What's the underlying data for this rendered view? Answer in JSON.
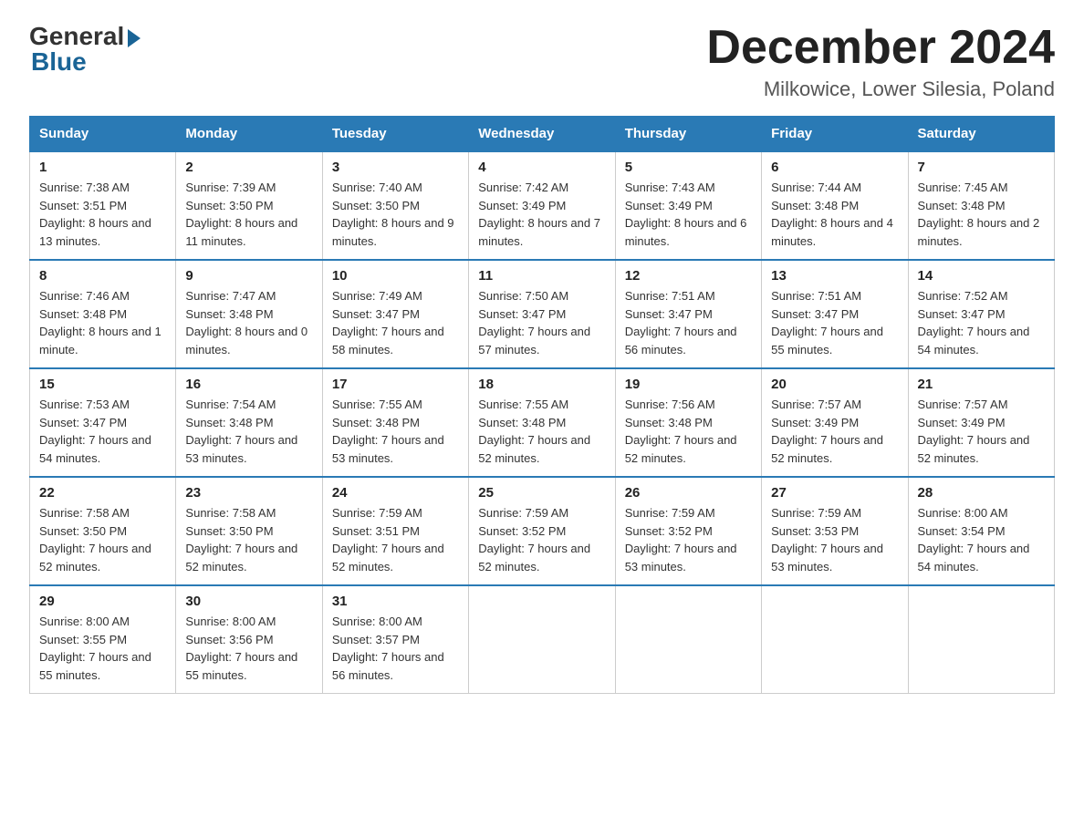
{
  "logo": {
    "general": "General",
    "blue": "Blue"
  },
  "header": {
    "month_year": "December 2024",
    "location": "Milkowice, Lower Silesia, Poland"
  },
  "days_of_week": [
    "Sunday",
    "Monday",
    "Tuesday",
    "Wednesday",
    "Thursday",
    "Friday",
    "Saturday"
  ],
  "weeks": [
    [
      {
        "day": "1",
        "sunrise": "Sunrise: 7:38 AM",
        "sunset": "Sunset: 3:51 PM",
        "daylight": "Daylight: 8 hours and 13 minutes."
      },
      {
        "day": "2",
        "sunrise": "Sunrise: 7:39 AM",
        "sunset": "Sunset: 3:50 PM",
        "daylight": "Daylight: 8 hours and 11 minutes."
      },
      {
        "day": "3",
        "sunrise": "Sunrise: 7:40 AM",
        "sunset": "Sunset: 3:50 PM",
        "daylight": "Daylight: 8 hours and 9 minutes."
      },
      {
        "day": "4",
        "sunrise": "Sunrise: 7:42 AM",
        "sunset": "Sunset: 3:49 PM",
        "daylight": "Daylight: 8 hours and 7 minutes."
      },
      {
        "day": "5",
        "sunrise": "Sunrise: 7:43 AM",
        "sunset": "Sunset: 3:49 PM",
        "daylight": "Daylight: 8 hours and 6 minutes."
      },
      {
        "day": "6",
        "sunrise": "Sunrise: 7:44 AM",
        "sunset": "Sunset: 3:48 PM",
        "daylight": "Daylight: 8 hours and 4 minutes."
      },
      {
        "day": "7",
        "sunrise": "Sunrise: 7:45 AM",
        "sunset": "Sunset: 3:48 PM",
        "daylight": "Daylight: 8 hours and 2 minutes."
      }
    ],
    [
      {
        "day": "8",
        "sunrise": "Sunrise: 7:46 AM",
        "sunset": "Sunset: 3:48 PM",
        "daylight": "Daylight: 8 hours and 1 minute."
      },
      {
        "day": "9",
        "sunrise": "Sunrise: 7:47 AM",
        "sunset": "Sunset: 3:48 PM",
        "daylight": "Daylight: 8 hours and 0 minutes."
      },
      {
        "day": "10",
        "sunrise": "Sunrise: 7:49 AM",
        "sunset": "Sunset: 3:47 PM",
        "daylight": "Daylight: 7 hours and 58 minutes."
      },
      {
        "day": "11",
        "sunrise": "Sunrise: 7:50 AM",
        "sunset": "Sunset: 3:47 PM",
        "daylight": "Daylight: 7 hours and 57 minutes."
      },
      {
        "day": "12",
        "sunrise": "Sunrise: 7:51 AM",
        "sunset": "Sunset: 3:47 PM",
        "daylight": "Daylight: 7 hours and 56 minutes."
      },
      {
        "day": "13",
        "sunrise": "Sunrise: 7:51 AM",
        "sunset": "Sunset: 3:47 PM",
        "daylight": "Daylight: 7 hours and 55 minutes."
      },
      {
        "day": "14",
        "sunrise": "Sunrise: 7:52 AM",
        "sunset": "Sunset: 3:47 PM",
        "daylight": "Daylight: 7 hours and 54 minutes."
      }
    ],
    [
      {
        "day": "15",
        "sunrise": "Sunrise: 7:53 AM",
        "sunset": "Sunset: 3:47 PM",
        "daylight": "Daylight: 7 hours and 54 minutes."
      },
      {
        "day": "16",
        "sunrise": "Sunrise: 7:54 AM",
        "sunset": "Sunset: 3:48 PM",
        "daylight": "Daylight: 7 hours and 53 minutes."
      },
      {
        "day": "17",
        "sunrise": "Sunrise: 7:55 AM",
        "sunset": "Sunset: 3:48 PM",
        "daylight": "Daylight: 7 hours and 53 minutes."
      },
      {
        "day": "18",
        "sunrise": "Sunrise: 7:55 AM",
        "sunset": "Sunset: 3:48 PM",
        "daylight": "Daylight: 7 hours and 52 minutes."
      },
      {
        "day": "19",
        "sunrise": "Sunrise: 7:56 AM",
        "sunset": "Sunset: 3:48 PM",
        "daylight": "Daylight: 7 hours and 52 minutes."
      },
      {
        "day": "20",
        "sunrise": "Sunrise: 7:57 AM",
        "sunset": "Sunset: 3:49 PM",
        "daylight": "Daylight: 7 hours and 52 minutes."
      },
      {
        "day": "21",
        "sunrise": "Sunrise: 7:57 AM",
        "sunset": "Sunset: 3:49 PM",
        "daylight": "Daylight: 7 hours and 52 minutes."
      }
    ],
    [
      {
        "day": "22",
        "sunrise": "Sunrise: 7:58 AM",
        "sunset": "Sunset: 3:50 PM",
        "daylight": "Daylight: 7 hours and 52 minutes."
      },
      {
        "day": "23",
        "sunrise": "Sunrise: 7:58 AM",
        "sunset": "Sunset: 3:50 PM",
        "daylight": "Daylight: 7 hours and 52 minutes."
      },
      {
        "day": "24",
        "sunrise": "Sunrise: 7:59 AM",
        "sunset": "Sunset: 3:51 PM",
        "daylight": "Daylight: 7 hours and 52 minutes."
      },
      {
        "day": "25",
        "sunrise": "Sunrise: 7:59 AM",
        "sunset": "Sunset: 3:52 PM",
        "daylight": "Daylight: 7 hours and 52 minutes."
      },
      {
        "day": "26",
        "sunrise": "Sunrise: 7:59 AM",
        "sunset": "Sunset: 3:52 PM",
        "daylight": "Daylight: 7 hours and 53 minutes."
      },
      {
        "day": "27",
        "sunrise": "Sunrise: 7:59 AM",
        "sunset": "Sunset: 3:53 PM",
        "daylight": "Daylight: 7 hours and 53 minutes."
      },
      {
        "day": "28",
        "sunrise": "Sunrise: 8:00 AM",
        "sunset": "Sunset: 3:54 PM",
        "daylight": "Daylight: 7 hours and 54 minutes."
      }
    ],
    [
      {
        "day": "29",
        "sunrise": "Sunrise: 8:00 AM",
        "sunset": "Sunset: 3:55 PM",
        "daylight": "Daylight: 7 hours and 55 minutes."
      },
      {
        "day": "30",
        "sunrise": "Sunrise: 8:00 AM",
        "sunset": "Sunset: 3:56 PM",
        "daylight": "Daylight: 7 hours and 55 minutes."
      },
      {
        "day": "31",
        "sunrise": "Sunrise: 8:00 AM",
        "sunset": "Sunset: 3:57 PM",
        "daylight": "Daylight: 7 hours and 56 minutes."
      },
      null,
      null,
      null,
      null
    ]
  ]
}
